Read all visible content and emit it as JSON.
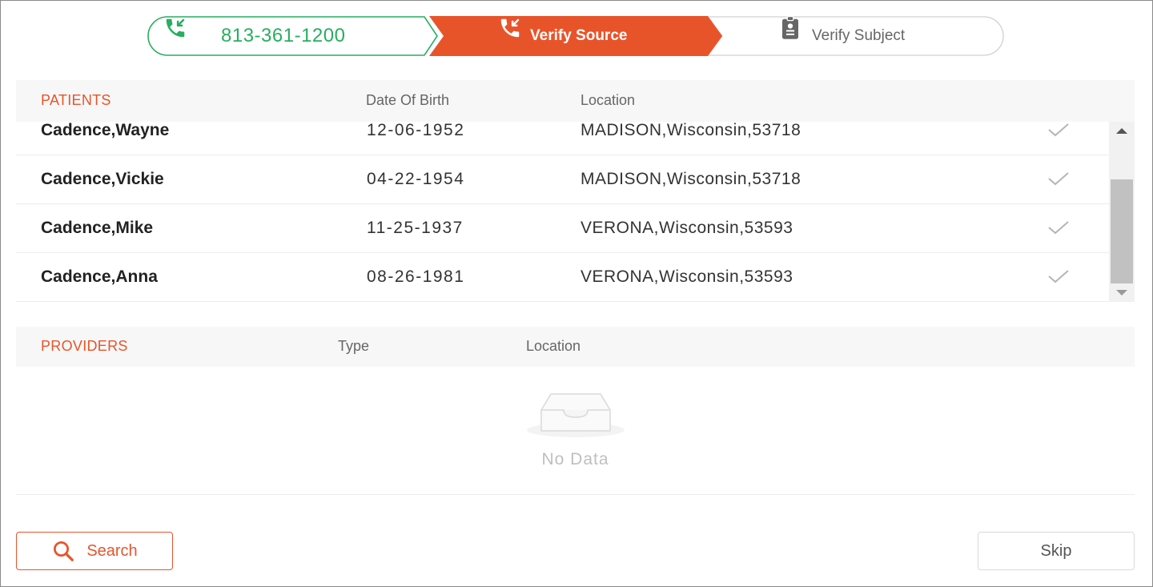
{
  "stepper": {
    "phone": {
      "number": "813-361-1200",
      "icon": "phone-incoming-icon",
      "color": "#27ae60"
    },
    "steps": [
      {
        "label": "Verify Source",
        "icon": "phone-incoming-icon",
        "state": "active",
        "color": "#e8542a"
      },
      {
        "label": "Verify Subject",
        "icon": "id-badge-icon",
        "state": "inactive"
      }
    ]
  },
  "patients": {
    "header": {
      "title": "PATIENTS",
      "dob": "Date Of Birth",
      "location": "Location"
    },
    "rows": [
      {
        "name": "Cadence,Wayne",
        "dob": "12-06-1952",
        "location": "MADISON,Wisconsin,53718",
        "icon": "check-icon"
      },
      {
        "name": "Cadence,Vickie",
        "dob": "04-22-1954",
        "location": "MADISON,Wisconsin,53718",
        "icon": "check-icon"
      },
      {
        "name": "Cadence,Mike",
        "dob": "11-25-1937",
        "location": "VERONA,Wisconsin,53593",
        "icon": "check-icon"
      },
      {
        "name": "Cadence,Anna",
        "dob": "08-26-1981",
        "location": "VERONA,Wisconsin,53593",
        "icon": "check-icon"
      }
    ]
  },
  "providers": {
    "header": {
      "title": "PROVIDERS",
      "type": "Type",
      "location": "Location"
    },
    "empty_text": "No Data",
    "empty_icon": "empty-inbox-icon"
  },
  "buttons": {
    "search": {
      "label": "Search",
      "icon": "search-icon"
    },
    "skip": {
      "label": "Skip"
    }
  },
  "colors": {
    "accent": "#e8542a",
    "success": "#27ae60"
  }
}
